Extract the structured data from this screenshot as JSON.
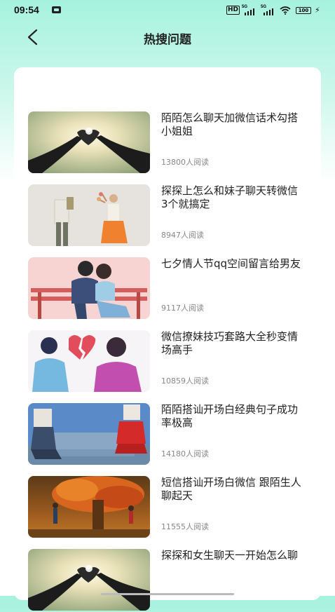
{
  "status_bar": {
    "time": "09:54",
    "hd": "HD",
    "net1": "5G",
    "net2": "5G",
    "battery": "100"
  },
  "header": {
    "title": "热搜问题",
    "back_icon": "back-arrow-icon"
  },
  "articles": [
    {
      "title": "陌陌怎么聊天加微信话术勾搭小姐姐",
      "reads": "13800人阅读",
      "image": "hearts-hands-sky"
    },
    {
      "title": "探探上怎么和妹子聊天转微信 3个就搞定",
      "reads": "8947人阅读",
      "image": "couple-flowers"
    },
    {
      "title": "七夕情人节qq空间留言给男友",
      "reads": "9117人阅读",
      "image": "couple-bench"
    },
    {
      "title": "微信撩妹技巧套路大全秒变情场高手",
      "reads": "10859人阅读",
      "image": "broken-heart"
    },
    {
      "title": "陌陌搭讪开场白经典句子成功率极高",
      "reads": "14180人阅读",
      "image": "sofa-masks"
    },
    {
      "title": "短信搭讪开场白微信 跟陌生人聊起天",
      "reads": "11555人阅读",
      "image": "autumn-tree"
    },
    {
      "title": "探探和女生聊天一开始怎么聊",
      "reads": "",
      "image": "hearts-hands-sky"
    }
  ]
}
